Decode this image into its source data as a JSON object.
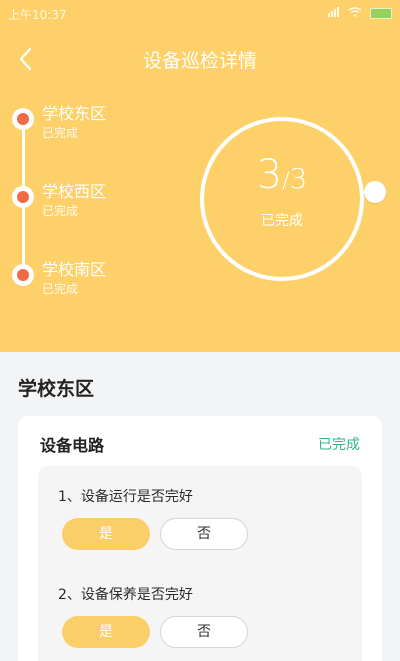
{
  "status_bar": {
    "time": "上午10:37",
    "icons": [
      "signal-icon",
      "wifi-icon",
      "battery-icon"
    ]
  },
  "header": {
    "title": "设备巡检详情",
    "bg_color": "#fdd06a"
  },
  "zones": [
    {
      "name": "学校东区",
      "status": "已完成"
    },
    {
      "name": "学校西区",
      "status": "已完成"
    },
    {
      "name": "学校南区",
      "status": "已完成"
    }
  ],
  "progress": {
    "done": "3",
    "separator": "/",
    "total": "3",
    "label": "已完成",
    "fraction": 1.0
  },
  "section": {
    "title": "学校东区"
  },
  "card": {
    "title": "设备电路",
    "status": "已完成",
    "status_color": "#31b48b",
    "questions": [
      {
        "text": "1、设备运行是否完好",
        "yes_label": "是",
        "no_label": "否",
        "selected": "yes"
      },
      {
        "text": "2、设备保养是否完好",
        "yes_label": "是",
        "no_label": "否",
        "selected": "yes"
      }
    ]
  }
}
